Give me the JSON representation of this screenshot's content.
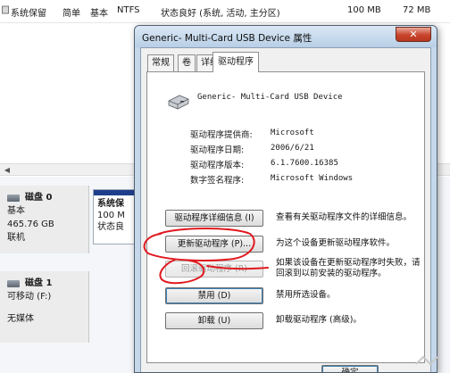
{
  "background": {
    "volume_row": {
      "name": "系统保留",
      "layout": "简单",
      "type": "基本",
      "fs": "NTFS",
      "status": "状态良好 (系统, 活动, 主分区)",
      "capacity": "100 MB",
      "free": "72 MB"
    },
    "disk0": {
      "title": "磁盘 0",
      "type": "基本",
      "size": "465.76 GB",
      "status": "联机",
      "partition": {
        "name": "系统保",
        "size": "100 M",
        "status": "状态良"
      }
    },
    "disk1": {
      "title": "磁盘 1",
      "type": "可移动 (F:)",
      "media": "无媒体"
    }
  },
  "dialog": {
    "title": "Generic- Multi-Card USB Device 属性",
    "close_label": "✕",
    "tabs": [
      {
        "label": "常规",
        "active": false
      },
      {
        "label": "卷",
        "active": false
      },
      {
        "label": "驱动程序",
        "active": true
      },
      {
        "label": "详细信息",
        "active": false
      }
    ],
    "device_name": "Generic- Multi-Card USB Device",
    "info": [
      {
        "label": "驱动程序提供商:",
        "value": "Microsoft"
      },
      {
        "label": "驱动程序日期:",
        "value": "2006/6/21"
      },
      {
        "label": "驱动程序版本:",
        "value": "6.1.7600.16385"
      },
      {
        "label": "数字签名程序:",
        "value": "Microsoft Windows"
      }
    ],
    "actions": [
      {
        "label": "驱动程序详细信息 (I)",
        "desc": "查看有关驱动程序文件的详细信息。",
        "enabled": true
      },
      {
        "label": "更新驱动程序 (P)...",
        "desc": "为这个设备更新驱动程序软件。",
        "enabled": true
      },
      {
        "label": "回滚驱动程序 (R)",
        "desc": "如果该设备在更新驱动程序时失败，请回滚到以前安装的驱动程序。",
        "enabled": false
      },
      {
        "label": "禁用 (D)",
        "desc": "禁用所选设备。",
        "enabled": true
      },
      {
        "label": "卸载 (U)",
        "desc": "卸载驱动程序 (高级)。",
        "enabled": true
      }
    ],
    "ok_label": "确定"
  },
  "colors": {
    "annotation_red": "#e0191f",
    "partition_bar": "#1f3f8c",
    "title_bar": "#c5d7ea"
  }
}
